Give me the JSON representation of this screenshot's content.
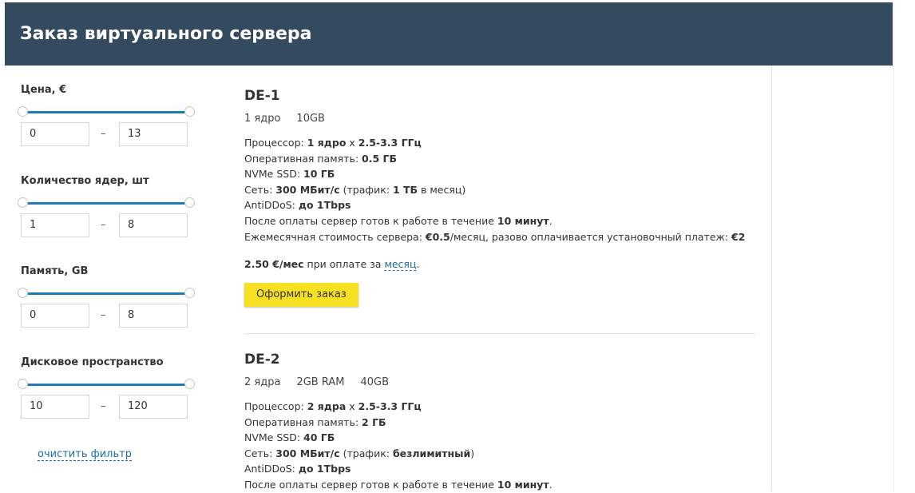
{
  "header": {
    "title": "Заказ виртуального сервера"
  },
  "filters": [
    {
      "label": "Цена, €",
      "from": "0",
      "to": "13"
    },
    {
      "label": "Количество ядер, шт",
      "from": "1",
      "to": "8"
    },
    {
      "label": "Память, GB",
      "from": "0",
      "to": "8"
    },
    {
      "label": "Дисковое пространство",
      "from": "10",
      "to": "120"
    }
  ],
  "range_separator": "–",
  "clear_filter": "очистить фильтр",
  "products": [
    {
      "title": "DE-1",
      "tags": [
        "1 ядро",
        "10GB"
      ],
      "specs": {
        "cpu_label": "Процессор: ",
        "cpu_cores": "1 ядро",
        "cpu_x": " x ",
        "cpu_freq": "2.5-3.3 ГГц",
        "ram_label": "Оперативная память: ",
        "ram_value": "0.5 ГБ",
        "ssd_label": "NVMe SSD: ",
        "ssd_value": "10 ГБ",
        "net_label": "Сеть: ",
        "net_value": "300 МБит/с",
        "traffic_open": " (трафик: ",
        "traffic_value": "1 ТБ",
        "traffic_close": " в месяц)",
        "ddos_label": "AntiDDoS: ",
        "ddos_value": "до 1Tbps",
        "ready_label": "После оплаты сервер готов к работе в течение ",
        "ready_value": "10 минут",
        "ready_end": ".",
        "monthly_label": "Ежемесячная стоимость сервера: ",
        "monthly_value": "€0.5",
        "monthly_mid": "/месяц, разово оплачивается установочный платеж: ",
        "setup_value": "€2"
      },
      "price": {
        "value": "2.50 €/мес",
        "text": " при оплате за ",
        "period": "месяц",
        "end": "."
      },
      "order_button": "Оформить заказ"
    },
    {
      "title": "DE-2",
      "tags": [
        "2 ядра",
        "2GB RAM",
        "40GB"
      ],
      "specs": {
        "cpu_label": "Процессор: ",
        "cpu_cores": "2 ядра",
        "cpu_x": " x ",
        "cpu_freq": "2.5-3.3 ГГц",
        "ram_label": "Оперативная память: ",
        "ram_value": "2 ГБ",
        "ssd_label": "NVMe SSD: ",
        "ssd_value": "40 ГБ",
        "net_label": "Сеть: ",
        "net_value": "300 МБит/с",
        "traffic_open": " (трафик: ",
        "traffic_value": "безлимитный",
        "traffic_close": ")",
        "ddos_label": "AntiDDoS: ",
        "ddos_value": "до 1Tbps",
        "ready_label": "После оплаты сервер готов к работе в течение ",
        "ready_value": "10 минут",
        "ready_end": "."
      }
    }
  ]
}
